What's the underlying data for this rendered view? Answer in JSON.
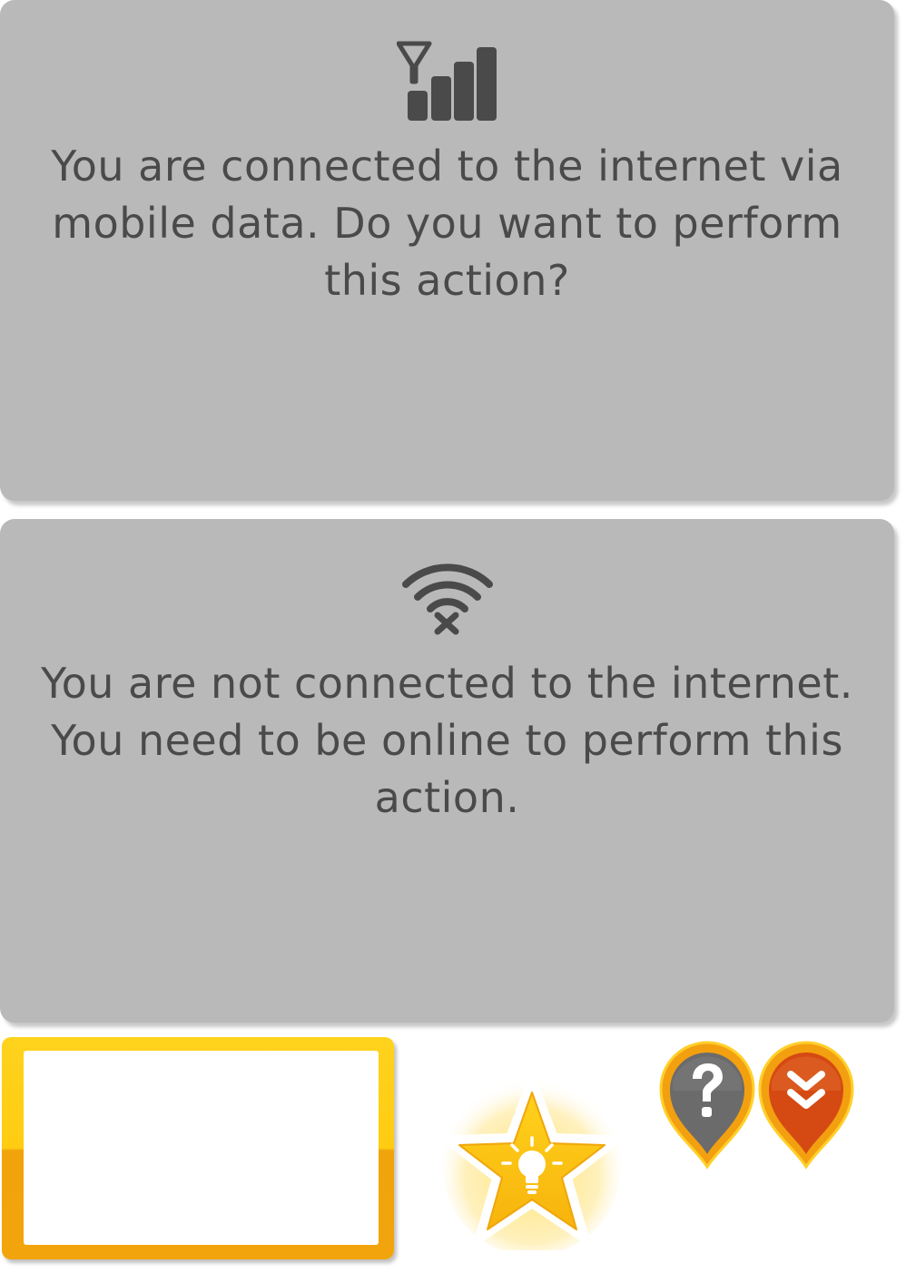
{
  "dialogs": {
    "mobile_data": {
      "icon": "signal-bars-icon",
      "message": "You are connected to the internet via mobile data. Do you want to perform this action?"
    },
    "offline": {
      "icon": "wifi-off-icon",
      "message": "You are not connected to the internet. You need to be online to perform this action."
    }
  },
  "assets": {
    "frame": {
      "name": "blank-frame",
      "color": "#ffc812"
    },
    "hint_star": {
      "icon": "lightbulb-star-icon",
      "color": "#ffc812"
    },
    "help_pin": {
      "icon": "question-mark-icon",
      "color": "#6b6b6b"
    },
    "scroll_pin": {
      "icon": "double-chevron-down-icon",
      "color": "#d54a12"
    }
  },
  "colors": {
    "panel_bg": "#b9b9b9",
    "text": "#4a4a4a",
    "accent": "#ffc812",
    "rim": "#f4a20e"
  }
}
